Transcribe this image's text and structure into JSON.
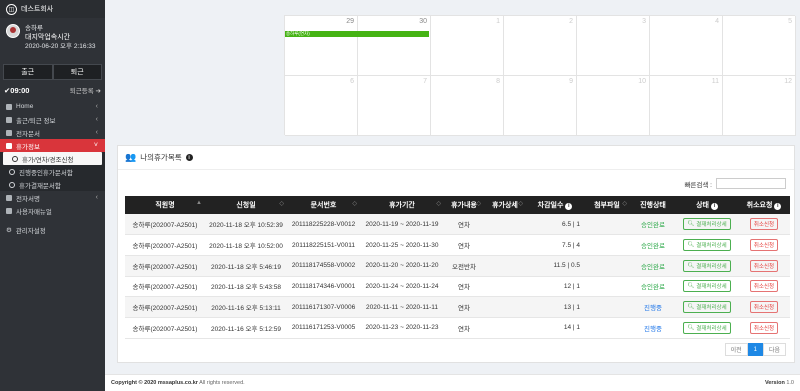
{
  "brand": {
    "name": "데스트회사",
    "logo_icon": "company-logo-icon"
  },
  "profile": {
    "name": "송하루",
    "status": "대지막업속시간",
    "datetime": "2020-06-20 오후 2:16:33"
  },
  "attendance": {
    "check_in": "출근",
    "check_out": "퇴근",
    "time": "09:00",
    "register": "퇴근등록"
  },
  "menu": [
    {
      "label": "Home",
      "chev": "‹"
    },
    {
      "label": "출근/퇴근 정보",
      "chev": "‹"
    },
    {
      "label": "전자문서",
      "chev": "‹"
    },
    {
      "label": "휴가정보",
      "chev": "˅"
    }
  ],
  "submenu": [
    {
      "label": "휴가/연차/경조신청"
    },
    {
      "label": "진행중인휴가문서함"
    },
    {
      "label": "휴가결재문서함"
    }
  ],
  "menu2": [
    {
      "label": "전자서명",
      "chev": "‹"
    },
    {
      "label": "사용자매뉴얼",
      "chev": ""
    },
    {
      "label": "관리자설정",
      "chev": ""
    }
  ],
  "calendar": {
    "days": [
      "29",
      "30",
      "1",
      "2",
      "3",
      "4",
      "5",
      "6",
      "7",
      "8",
      "9",
      "10",
      "11",
      "12"
    ],
    "event": "송하루(연차)"
  },
  "panel": {
    "title": "나의휴가목록",
    "search_label": "빠른검색 :",
    "search_placeholder": ""
  },
  "table": {
    "headers": [
      "직원명",
      "신청일",
      "문서번호",
      "휴가기간",
      "휴가내용",
      "휴가상세",
      "차감일수",
      "첨부파일",
      "진행상태",
      "상태",
      "취소요청"
    ],
    "rows": [
      {
        "name": "송하루(202007-A2501)",
        "date": "2020-11-18 오후 10:52:39",
        "doc": "201118225228-V0012",
        "period": "2020-11-19 ~ 2020-11-19",
        "content": "연차",
        "detail": "",
        "days": "6.5 | 1",
        "file": "",
        "progress": "승인완료",
        "pclass": "st-ok",
        "status": "결재처리상세",
        "cancel": "취소신청"
      },
      {
        "name": "송하루(202007-A2501)",
        "date": "2020-11-18 오후 10:52:00",
        "doc": "201118225151-V0011",
        "period": "2020-11-25 ~ 2020-11-30",
        "content": "연차",
        "detail": "",
        "days": "7.5 | 4",
        "file": "",
        "progress": "승인완료",
        "pclass": "st-ok",
        "status": "결재처리상세",
        "cancel": "취소신청"
      },
      {
        "name": "송하루(202007-A2501)",
        "date": "2020-11-18 오후 5:46:19",
        "doc": "201118174558-V0002",
        "period": "2020-11-20 ~ 2020-11-20",
        "content": "오전반차",
        "detail": "",
        "days": "11.5 | 0.5",
        "file": "",
        "progress": "승인완료",
        "pclass": "st-ok",
        "status": "결재처리상세",
        "cancel": "취소신청"
      },
      {
        "name": "송하루(202007-A2501)",
        "date": "2020-11-18 오후 5:43:58",
        "doc": "201118174346-V0001",
        "period": "2020-11-24 ~ 2020-11-24",
        "content": "연차",
        "detail": "",
        "days": "12 | 1",
        "file": "",
        "progress": "승인완료",
        "pclass": "st-ok",
        "status": "결재처리상세",
        "cancel": "취소신청"
      },
      {
        "name": "송하루(202007-A2501)",
        "date": "2020-11-16 오후 5:13:11",
        "doc": "201116171307-V0006",
        "period": "2020-11-11 ~ 2020-11-11",
        "content": "연차",
        "detail": "",
        "days": "13 | 1",
        "file": "",
        "progress": "진행중",
        "pclass": "st-prog",
        "status": "결재처리상세",
        "cancel": "취소신청"
      },
      {
        "name": "송하루(202007-A2501)",
        "date": "2020-11-16 오후 5:12:59",
        "doc": "201116171253-V0005",
        "period": "2020-11-23 ~ 2020-11-23",
        "content": "연차",
        "detail": "",
        "days": "14 | 1",
        "file": "",
        "progress": "진행중",
        "pclass": "st-prog",
        "status": "결재처리상세",
        "cancel": "취소신청"
      }
    ]
  },
  "pager": {
    "prev": "이전",
    "current": "1",
    "next": "다음"
  },
  "footer": {
    "copyright_prefix": "Copyright © 2020",
    "site": "mssaplus.co.kr",
    "rights": "All rights reserved.",
    "version_label": "Version",
    "version": "1.0"
  }
}
